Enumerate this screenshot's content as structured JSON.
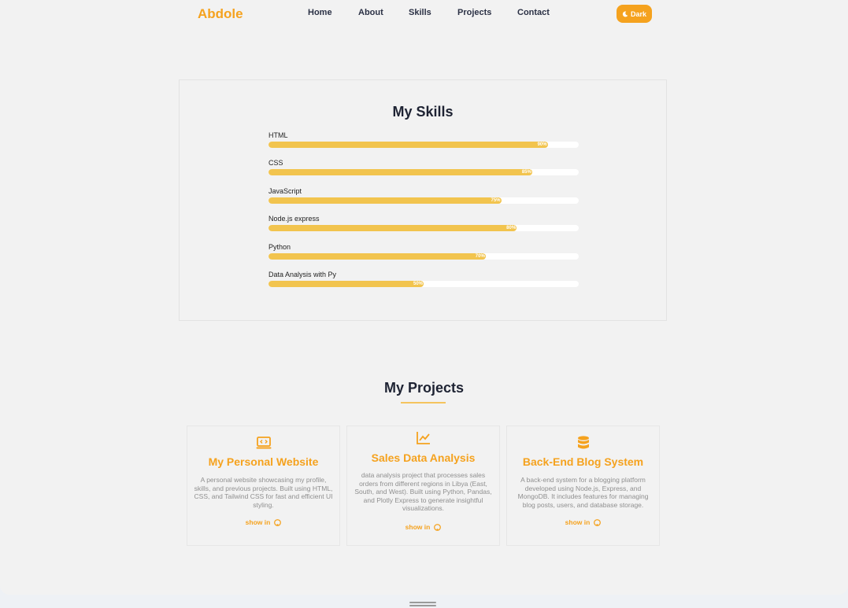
{
  "brand": "Abdole",
  "nav": {
    "items": [
      "Home",
      "About",
      "Skills",
      "Projects",
      "Contact"
    ],
    "theme_button": "Dark"
  },
  "skills": {
    "title": "My Skills",
    "items": [
      {
        "name": "HTML",
        "percent": 90,
        "label": "90%"
      },
      {
        "name": "CSS",
        "percent": 85,
        "label": "85%"
      },
      {
        "name": "JavaScript",
        "percent": 75,
        "label": "75%"
      },
      {
        "name": "Node.js express",
        "percent": 80,
        "label": "80%"
      },
      {
        "name": "Python",
        "percent": 70,
        "label": "70%"
      },
      {
        "name": "Data Analysis with Py",
        "percent": 50,
        "label": "50%"
      }
    ]
  },
  "projects": {
    "title": "My Projects",
    "items": [
      {
        "icon": "laptop-code-icon",
        "title": "My Personal Website",
        "description": "A personal website showcasing my profile, skills, and previous projects. Built using HTML, CSS, and Tailwind CSS for fast and efficient UI styling.",
        "link": "show in"
      },
      {
        "icon": "chart-line-icon",
        "title": "Sales Data Analysis",
        "description": "data analysis project that processes sales orders from different regions in Libya (East, South, and West). Built using Python, Pandas, and Plotly Express to generate insightful visualizations.",
        "link": "show in"
      },
      {
        "icon": "database-icon",
        "title": "Back-End Blog System",
        "description": "A back-end system for a blogging platform developed using Node.js, Express, and MongoDB. It includes features for managing blog posts, users, and database storage.",
        "link": "show in"
      }
    ]
  },
  "colors": {
    "accent": "#f5a21e",
    "bar": "#f2c44e",
    "background": "#f2f2f2"
  }
}
